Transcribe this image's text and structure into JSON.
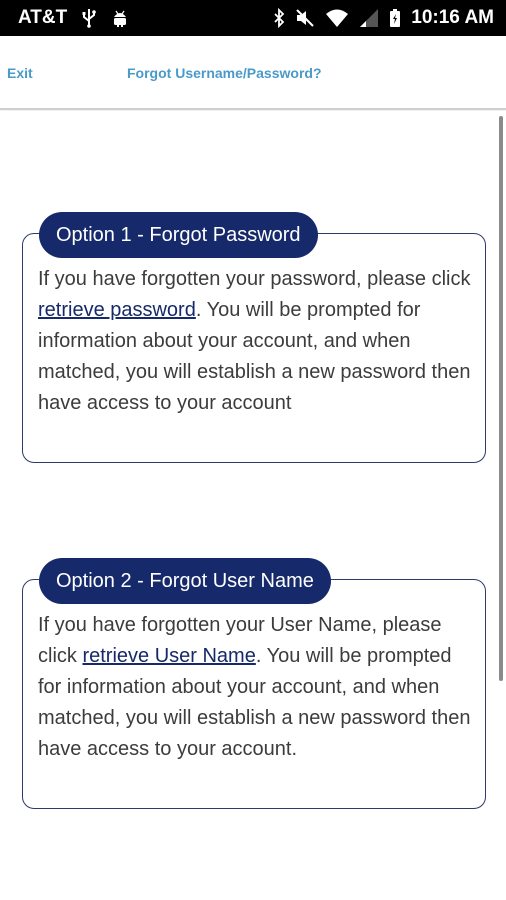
{
  "status_bar": {
    "carrier": "AT&T",
    "time": "10:16 AM"
  },
  "header": {
    "exit_label": "Exit",
    "title": "Forgot Username/Password?"
  },
  "options": [
    {
      "tag": "Option 1 - Forgot Password",
      "text_before": "If you have forgotten your password, please click ",
      "link_label": "retrieve password",
      "text_after": ". You will be prompted for information about your account, and when matched, you will establish a new password then have access to your account"
    },
    {
      "tag": "Option 2 - Forgot User Name",
      "text_before": "If you have forgotten your User Name, please click ",
      "link_label": "retrieve User Name",
      "text_after": ". You will be prompted for information about your account, and when matched, you will establish a new password then have access to your account."
    }
  ],
  "colors": {
    "header_link": "#4a9ac9",
    "tag_background": "#16296a",
    "box_border": "#2e3a6b",
    "body_text": "#3c3c3c"
  },
  "icons": [
    "usb-icon",
    "android-icon",
    "bluetooth-icon",
    "mute-icon",
    "wifi-icon",
    "signal-icon",
    "battery-icon"
  ]
}
